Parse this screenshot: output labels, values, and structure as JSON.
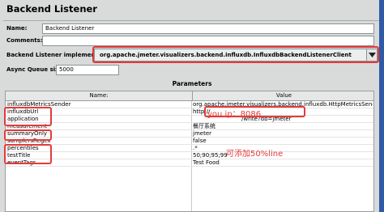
{
  "panel": {
    "title": "Backend Listener"
  },
  "form": {
    "name_label": "Name:",
    "name_value": "Backend Listener",
    "comments_label": "Comments:",
    "comments_value": "",
    "impl_label": "Backend Listener implementation",
    "impl_value": "org.apache.jmeter.visualizers.backend.influxdb.InfluxdbBackendListenerClient",
    "queue_label": "Async Queue size",
    "queue_value": "5000"
  },
  "parameters": {
    "title": "Parameters",
    "columns": {
      "name": "Name:",
      "value": "Value"
    },
    "rows": [
      {
        "name": "influxdbMetricsSender",
        "value": "org.apache.jmeter.visualizers.backend.influxdb.HttpMetricsSender"
      },
      {
        "name": "influxdbUrl",
        "value": "http://"
      },
      {
        "name": "application",
        "value": "",
        "value_suffix": "/write?db=jmeter"
      },
      {
        "name": "measurement",
        "value": "餐厅系统"
      },
      {
        "name": "summaryOnly",
        "value": "jmeter"
      },
      {
        "name": "samplersRegex",
        "value": "false"
      },
      {
        "name": "percentiles",
        "value": ".*"
      },
      {
        "name": "testTitle",
        "value": "50;90;95;99"
      },
      {
        "name": "eventTags",
        "value": "Test Food"
      }
    ]
  },
  "annotations": {
    "ip_note": "you ip：8086",
    "percentile_note": "可添加50%line"
  },
  "colors": {
    "highlight": "#e53a3a",
    "background": "#d9dbdb"
  }
}
